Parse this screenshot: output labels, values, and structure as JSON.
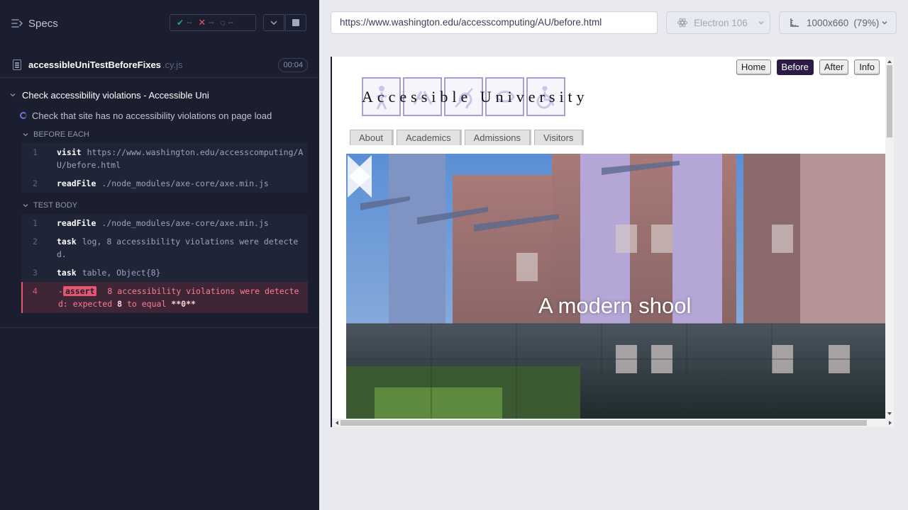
{
  "reporter": {
    "header": {
      "title": "Specs",
      "passed": "--",
      "failed": "--",
      "pending": "--"
    },
    "spec": {
      "name": "accessibleUniTestBeforeFixes",
      "ext": ".cy.js",
      "duration": "00:04"
    },
    "suite": {
      "title": "Check accessibility violations - Accessible Uni"
    },
    "test": {
      "title": "Check that site has no accessibility violations on page load"
    },
    "before_each": {
      "label": "BEFORE EACH",
      "commands": [
        {
          "num": "1",
          "name": "visit",
          "message": "https://www.washington.edu/accesscomputing/AU/before.html"
        },
        {
          "num": "2",
          "name": "readFile",
          "message": "./node_modules/axe-core/axe.min.js"
        }
      ]
    },
    "test_body": {
      "label": "TEST BODY",
      "commands": [
        {
          "num": "1",
          "name": "readFile",
          "message": "./node_modules/axe-core/axe.min.js"
        },
        {
          "num": "2",
          "name": "task",
          "message": "log, 8 accessibility violations were detected."
        },
        {
          "num": "3",
          "name": "task",
          "message": "table, Object{8}"
        }
      ],
      "failed": {
        "num": "4",
        "prefix": "-",
        "badge": "assert",
        "message": "8 accessibility violations were detected: expected",
        "expected": "8",
        "to": "to equal",
        "actual": "**0**"
      }
    }
  },
  "app": {
    "url": "https://www.washington.edu/accesscomputing/AU/before.html",
    "browser": "Electron 106",
    "viewport": "1000x660",
    "scale": "(79%)",
    "site": {
      "logo_text": "Accessible University",
      "top_nav": [
        "Home",
        "Before",
        "After",
        "Info"
      ],
      "active_top_nav": "Before",
      "tabs": [
        "About",
        "Academics",
        "Admissions",
        "Visitors"
      ],
      "caption": "A modern shool"
    }
  },
  "colors": {
    "reporter_bg": "#1b1e2e",
    "fail": "#e45770",
    "pass": "#1fa971",
    "active_nav": "#2c1c45"
  }
}
